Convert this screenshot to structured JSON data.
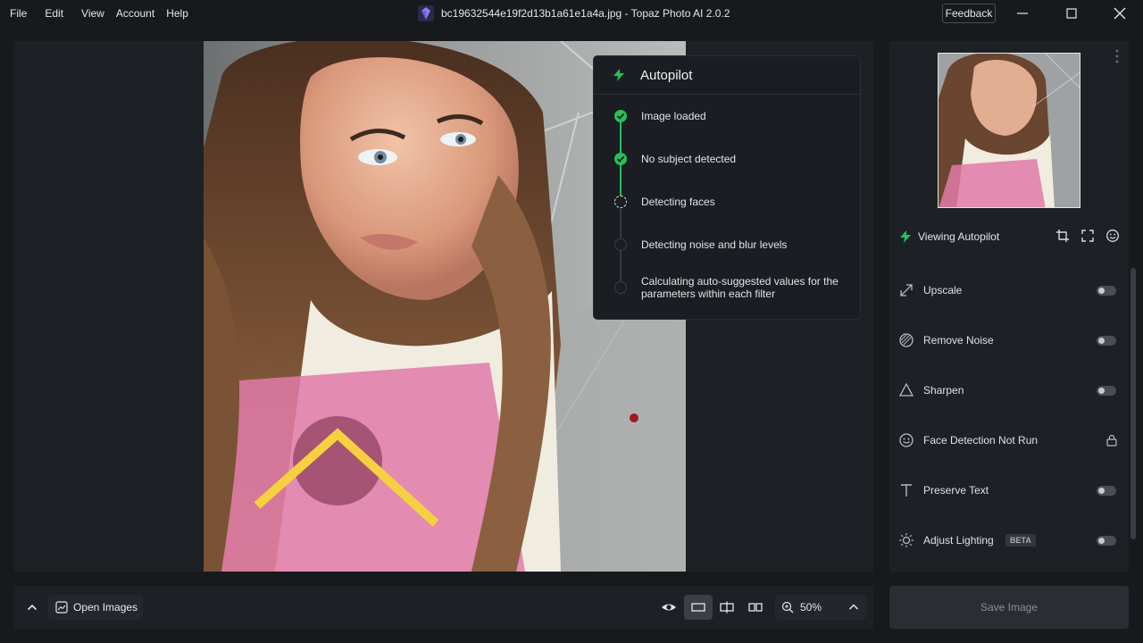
{
  "menu": [
    "File",
    "Edit",
    "View",
    "Account",
    "Help"
  ],
  "window": {
    "title": "bc19632544e19f2d13b1a61e1a4a.jpg - Topaz Photo AI 2.0.2",
    "feedback_label": "Feedback"
  },
  "autopilot": {
    "title": "Autopilot",
    "steps": [
      {
        "label": "Image loaded",
        "status": "done"
      },
      {
        "label": "No subject detected",
        "status": "done"
      },
      {
        "label": "Detecting faces",
        "status": "active"
      },
      {
        "label": "Detecting noise and blur levels",
        "status": "pending"
      },
      {
        "label": "Calculating auto-suggested values for the parameters within each filter",
        "status": "pending"
      }
    ]
  },
  "sidebar": {
    "viewing_label": "Viewing Autopilot",
    "filters": [
      {
        "label": "Upscale",
        "icon": "upscale-icon",
        "control": "toggle"
      },
      {
        "label": "Remove Noise",
        "icon": "remove-noise-icon",
        "control": "toggle"
      },
      {
        "label": "Sharpen",
        "icon": "sharpen-icon",
        "control": "toggle"
      },
      {
        "label": "Face Detection Not Run",
        "icon": "face-icon",
        "control": "lock"
      },
      {
        "label": "Preserve Text",
        "icon": "text-icon",
        "control": "toggle"
      },
      {
        "label": "Adjust Lighting",
        "icon": "lighting-icon",
        "control": "toggle",
        "badge": "BETA"
      }
    ]
  },
  "bottom": {
    "open_images_label": "Open Images",
    "zoom_label": "50%",
    "save_label": "Save Image"
  },
  "colors": {
    "accent_green": "#25c05a",
    "background": "#17191d",
    "panel": "#1d2025"
  }
}
